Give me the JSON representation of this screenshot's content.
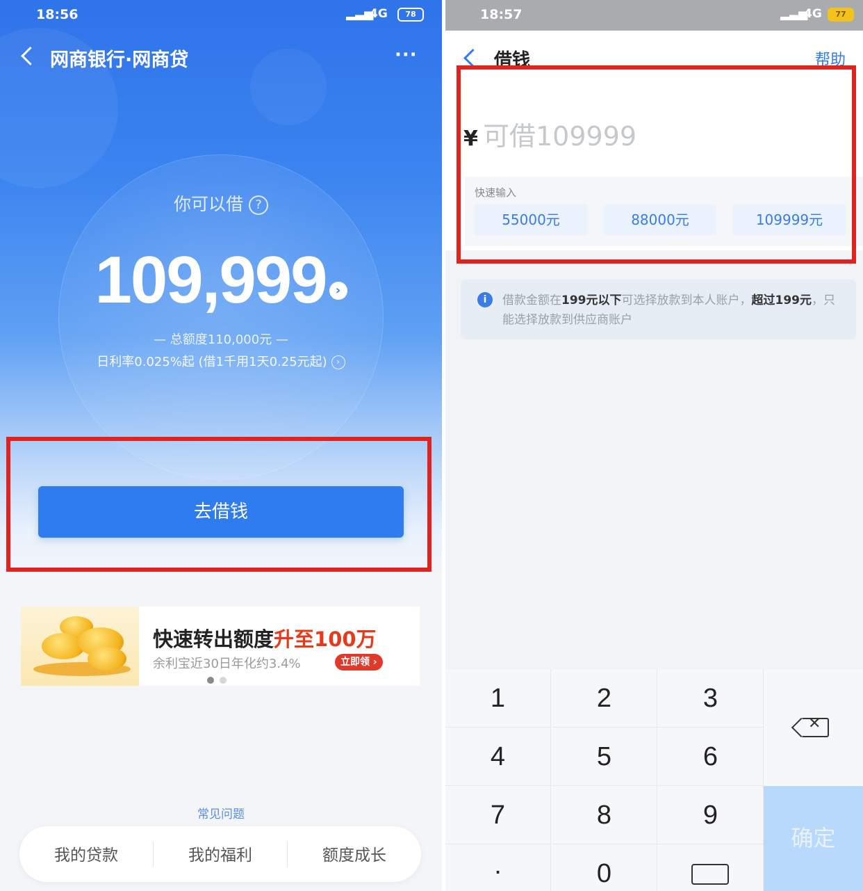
{
  "left": {
    "status": {
      "time": "18:56",
      "network": "4G",
      "battery": "78"
    },
    "nav": {
      "title": "网商银行·网商贷",
      "more": "···"
    },
    "hero": {
      "label": "你可以借",
      "amount": "109,999",
      "total": "— 总额度110,000元 —",
      "rate": "日利率0.025%起 (借1千用1天0.25元起)"
    },
    "borrow_button": "去借钱",
    "banner": {
      "title_main": "快速转出额度",
      "title_highlight": "升至100万",
      "subtitle": "余利宝近30日年化约3.4%",
      "tag": "立即领 ›"
    },
    "faq": "常见问题",
    "tabs": [
      "我的贷款",
      "我的福利",
      "额度成长"
    ]
  },
  "right": {
    "status": {
      "time": "18:57",
      "network": "4G",
      "battery": "77"
    },
    "nav": {
      "title": "借钱",
      "help": "帮助"
    },
    "input": {
      "currency": "¥",
      "placeholder": "可借109999"
    },
    "quick": {
      "label": "快速输入",
      "options": [
        "55000元",
        "88000元",
        "109999元"
      ]
    },
    "notice": {
      "p1": "借款金额在",
      "b1": "199元以下",
      "p2": "可选择放款到本人账户，",
      "b2": "超过199元",
      "p3": "，只能选择放款到供应商账户"
    },
    "keypad": {
      "keys": [
        "1",
        "2",
        "3",
        "4",
        "5",
        "6",
        "7",
        "8",
        "9",
        ".",
        "0"
      ],
      "confirm": "确定"
    }
  },
  "colors": {
    "primary": "#2f7bf0",
    "highlight_box": "#e0231f",
    "accent_red": "#e8391a"
  },
  "icons": [
    "back-icon",
    "more-icon",
    "question-icon",
    "arrow-right-icon",
    "info-icon",
    "backspace-icon",
    "keyboard-icon"
  ]
}
